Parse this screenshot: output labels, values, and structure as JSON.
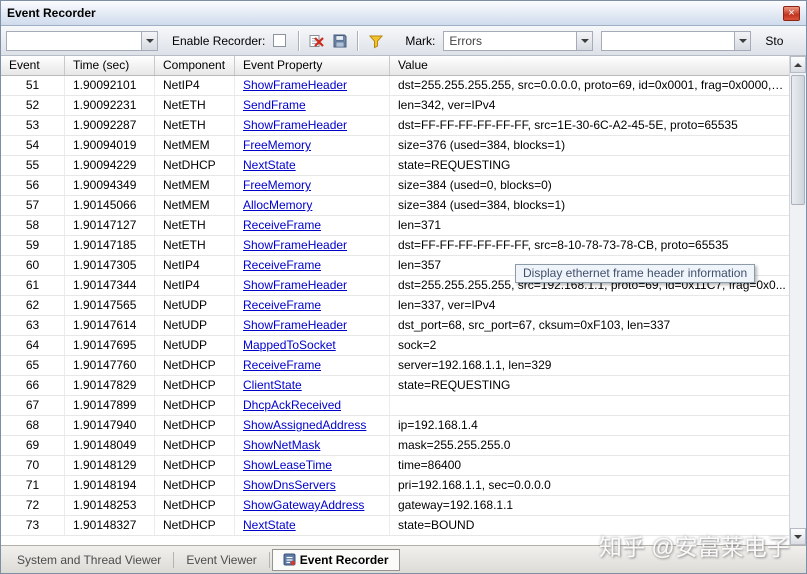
{
  "window": {
    "title": "Event Recorder"
  },
  "colors": {
    "link": "#0000cc",
    "close_button": "#c1341f",
    "filter_icon": "#f4c430"
  },
  "toolbar": {
    "recorder_combo_value": "",
    "enable_label": "Enable Recorder:",
    "enable_checked": false,
    "mark_label": "Mark:",
    "mark_combo_value": "Errors",
    "extra_combo_value": "",
    "stop_label": "Sto"
  },
  "table": {
    "columns": [
      "Event",
      "Time (sec)",
      "Component",
      "Event Property",
      "Value"
    ],
    "rows": [
      {
        "event": "51",
        "time": "1.90092101",
        "component": "NetIP4",
        "property": "ShowFrameHeader",
        "value": "dst=255.255.255.255, src=0.0.0.0, proto=69, id=0x0001, frag=0x0000, l..."
      },
      {
        "event": "52",
        "time": "1.90092231",
        "component": "NetETH",
        "property": "SendFrame",
        "value": "len=342, ver=IPv4"
      },
      {
        "event": "53",
        "time": "1.90092287",
        "component": "NetETH",
        "property": "ShowFrameHeader",
        "value": "dst=FF-FF-FF-FF-FF-FF, src=1E-30-6C-A2-45-5E, proto=65535"
      },
      {
        "event": "54",
        "time": "1.90094019",
        "component": "NetMEM",
        "property": "FreeMemory",
        "value": "size=376 (used=384, blocks=1)"
      },
      {
        "event": "55",
        "time": "1.90094229",
        "component": "NetDHCP",
        "property": "NextState",
        "value": "state=REQUESTING"
      },
      {
        "event": "56",
        "time": "1.90094349",
        "component": "NetMEM",
        "property": "FreeMemory",
        "value": "size=384 (used=0, blocks=0)"
      },
      {
        "event": "57",
        "time": "1.90145066",
        "component": "NetMEM",
        "property": "AllocMemory",
        "value": "size=384 (used=384, blocks=1)"
      },
      {
        "event": "58",
        "time": "1.90147127",
        "component": "NetETH",
        "property": "ReceiveFrame",
        "value": "len=371"
      },
      {
        "event": "59",
        "time": "1.90147185",
        "component": "NetETH",
        "property": "ShowFrameHeader",
        "value": "dst=FF-FF-FF-FF-FF-FF, src=8-10-78-73-78-CB, proto=65535"
      },
      {
        "event": "60",
        "time": "1.90147305",
        "component": "NetIP4",
        "property": "ReceiveFrame",
        "value": "len=357"
      },
      {
        "event": "61",
        "time": "1.90147344",
        "component": "NetIP4",
        "property": "ShowFrameHeader",
        "value": "dst=255.255.255.255, src=192.168.1.1, proto=69, id=0x11C7, frag=0x0..."
      },
      {
        "event": "62",
        "time": "1.90147565",
        "component": "NetUDP",
        "property": "ReceiveFrame",
        "value": "len=337, ver=IPv4"
      },
      {
        "event": "63",
        "time": "1.90147614",
        "component": "NetUDP",
        "property": "ShowFrameHeader",
        "value": "dst_port=68, src_port=67, cksum=0xF103, len=337"
      },
      {
        "event": "64",
        "time": "1.90147695",
        "component": "NetUDP",
        "property": "MappedToSocket",
        "value": "sock=2"
      },
      {
        "event": "65",
        "time": "1.90147760",
        "component": "NetDHCP",
        "property": "ReceiveFrame",
        "value": "server=192.168.1.1, len=329"
      },
      {
        "event": "66",
        "time": "1.90147829",
        "component": "NetDHCP",
        "property": "ClientState",
        "value": "state=REQUESTING"
      },
      {
        "event": "67",
        "time": "1.90147899",
        "component": "NetDHCP",
        "property": "DhcpAckReceived",
        "value": ""
      },
      {
        "event": "68",
        "time": "1.90147940",
        "component": "NetDHCP",
        "property": "ShowAssignedAddress",
        "value": "ip=192.168.1.4"
      },
      {
        "event": "69",
        "time": "1.90148049",
        "component": "NetDHCP",
        "property": "ShowNetMask",
        "value": "mask=255.255.255.0"
      },
      {
        "event": "70",
        "time": "1.90148129",
        "component": "NetDHCP",
        "property": "ShowLeaseTime",
        "value": "time=86400"
      },
      {
        "event": "71",
        "time": "1.90148194",
        "component": "NetDHCP",
        "property": "ShowDnsServers",
        "value": "pri=192.168.1.1, sec=0.0.0.0"
      },
      {
        "event": "72",
        "time": "1.90148253",
        "component": "NetDHCP",
        "property": "ShowGatewayAddress",
        "value": "gateway=192.168.1.1"
      },
      {
        "event": "73",
        "time": "1.90148327",
        "component": "NetDHCP",
        "property": "NextState",
        "value": "state=BOUND"
      }
    ]
  },
  "tooltip": {
    "text": "Display ethernet frame header information"
  },
  "tabs": [
    {
      "label": "System and Thread Viewer",
      "active": false
    },
    {
      "label": "Event Viewer",
      "active": false
    },
    {
      "label": "Event Recorder",
      "active": true
    }
  ],
  "watermark": "知乎 @安富莱电子"
}
